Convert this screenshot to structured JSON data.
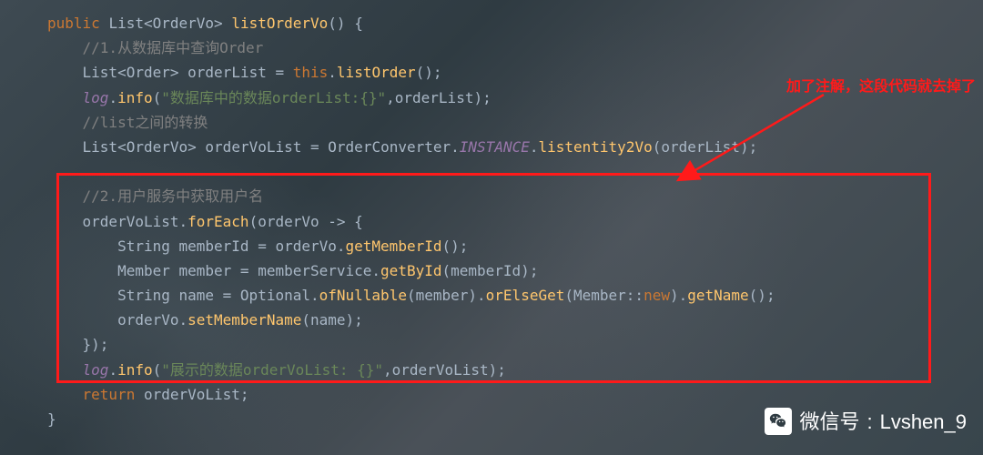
{
  "annotation": {
    "text": "加了注解，这段代码就去掉了"
  },
  "watermark": {
    "label": "微信号",
    "value": "Lvshen_9"
  },
  "code": {
    "l1": {
      "kw": "public",
      "sp": " ",
      "t1": "List",
      "lt": "<",
      "t2": "OrderVo",
      "gt": ">",
      "sp2": " ",
      "fn": "listOrderVo",
      "par": "() {"
    },
    "l2": {
      "cm": "//1.从数据库中查询Order"
    },
    "l3": {
      "t1": "List",
      "lt": "<",
      "t2": "Order",
      "gt": ">",
      "sp": " orderList = ",
      "kw": "this",
      "dot": ".",
      "fn": "listOrder",
      "par": "();"
    },
    "l4": {
      "fld": "log",
      "dot": ".",
      "fn": "info",
      "lp": "(",
      "str": "\"数据库中的数据orderList:{}\"",
      "rest": ",orderList);"
    },
    "l5": {
      "cm": "//list之间的转换"
    },
    "l6": {
      "t1": "List",
      "lt": "<",
      "t2": "OrderVo",
      "gt": ">",
      "sp": " orderVoList = ",
      "cls": "OrderConverter",
      "dot": ".",
      "cnst": "INSTANCE",
      "dot2": ".",
      "fn": "listentity2Vo",
      "par": "(orderList);"
    },
    "l7": "",
    "l8": {
      "cm": "//2.用户服务中获取用户名"
    },
    "l9": {
      "lhs": "orderVoList.",
      "fn": "forEach",
      "lp": "(orderVo -> {"
    },
    "l10": {
      "t": "String",
      "sp": " memberId = orderVo.",
      "fn": "getMemberId",
      "par": "();"
    },
    "l11": {
      "t": "Member",
      "sp": " member = memberService.",
      "fn": "getById",
      "par": "(memberId);"
    },
    "l12": {
      "t": "String",
      "sp": " name = Optional.",
      "fn1": "ofNullable",
      "p1": "(member).",
      "fn2": "orElseGet",
      "p2": "(Member::",
      "kw": "new",
      "p3": ").",
      "fn3": "getName",
      "p4": "();"
    },
    "l13": {
      "lhs": "orderVo.",
      "fn": "setMemberName",
      "par": "(name);"
    },
    "l14": {
      "txt": "});"
    },
    "l15": {
      "fld": "log",
      "dot": ".",
      "fn": "info",
      "lp": "(",
      "str": "\"展示的数据orderVoList: {}\"",
      "rest": ",orderVoList);"
    },
    "l16": {
      "kw": "return",
      "rest": " orderVoList;"
    },
    "l17": {
      "txt": "}"
    }
  }
}
